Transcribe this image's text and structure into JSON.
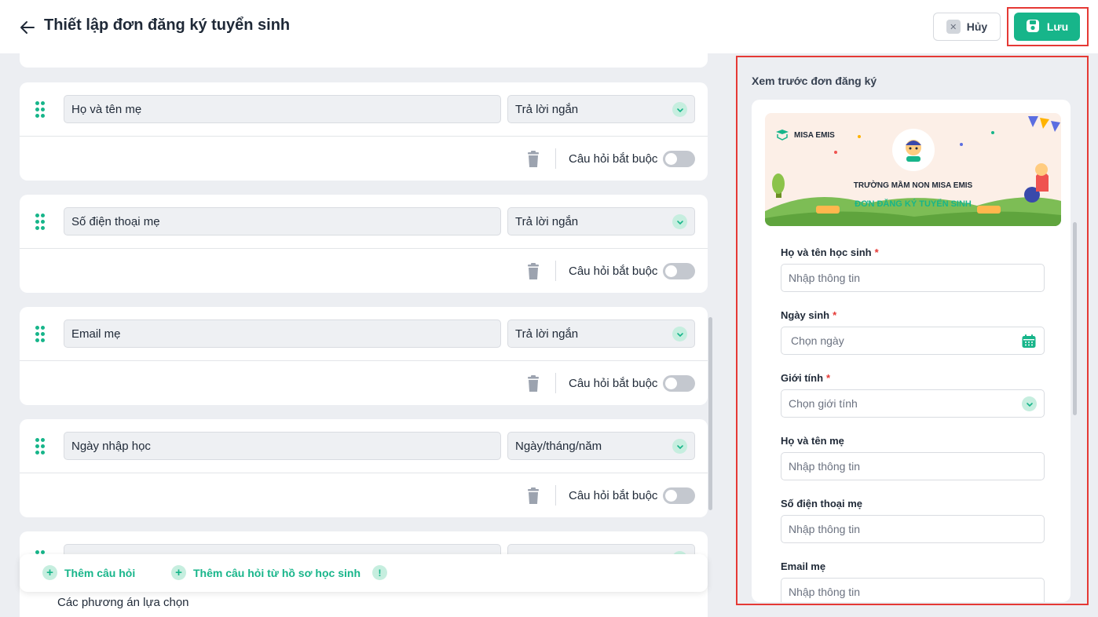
{
  "header": {
    "title": "Thiết lập đơn đăng ký tuyển sinh",
    "cancel_label": "Hủy",
    "save_label": "Lưu"
  },
  "questions": [
    {
      "label": "Họ và tên mẹ",
      "type": "Trả lời ngắn",
      "required_label": "Câu hỏi bắt buộc",
      "required": false
    },
    {
      "label": "Số điện thoại mẹ",
      "type": "Trả lời ngắn",
      "required_label": "Câu hỏi bắt buộc",
      "required": false
    },
    {
      "label": "Email mẹ",
      "type": "Trả lời ngắn",
      "required_label": "Câu hỏi bắt buộc",
      "required": false
    },
    {
      "label": "Ngày nhập học",
      "type": "Ngày/tháng/năm",
      "required_label": "Câu hỏi bắt buộc",
      "required": false
    }
  ],
  "partial_question": {
    "options_label": "Các phương án lựa chọn"
  },
  "add_bar": {
    "add_question": "Thêm câu hỏi",
    "add_from_profile": "Thêm câu hỏi từ hồ sơ học sinh",
    "info_glyph": "!"
  },
  "preview": {
    "title": "Xem trước đơn đăng ký",
    "banner": {
      "brand": "MISA EMIS",
      "school": "TRƯỜNG MẦM NON MISA EMIS",
      "form_title": "ĐƠN ĐĂNG KÝ TUYỂN SINH"
    },
    "fields": [
      {
        "label": "Họ và tên học sinh",
        "required": "*",
        "placeholder": "Nhập thông tin",
        "icon": ""
      },
      {
        "label": "Ngày sinh",
        "required": "*",
        "placeholder": "Chọn ngày",
        "icon": "calendar-icon"
      },
      {
        "label": "Giới tính",
        "required": "*",
        "placeholder": "Chọn giới tính",
        "icon": "chevron-down-icon"
      },
      {
        "label": "Họ và tên mẹ",
        "required": "",
        "placeholder": "Nhập thông tin",
        "icon": ""
      },
      {
        "label": "Số điện thoại mẹ",
        "required": "",
        "placeholder": "Nhập thông tin",
        "icon": ""
      },
      {
        "label": "Email mẹ",
        "required": "",
        "placeholder": "Nhập thông tin",
        "icon": ""
      }
    ]
  },
  "colors": {
    "accent": "#17b58a",
    "highlight": "#e53935",
    "toggle_off": "#c4c8cf"
  }
}
